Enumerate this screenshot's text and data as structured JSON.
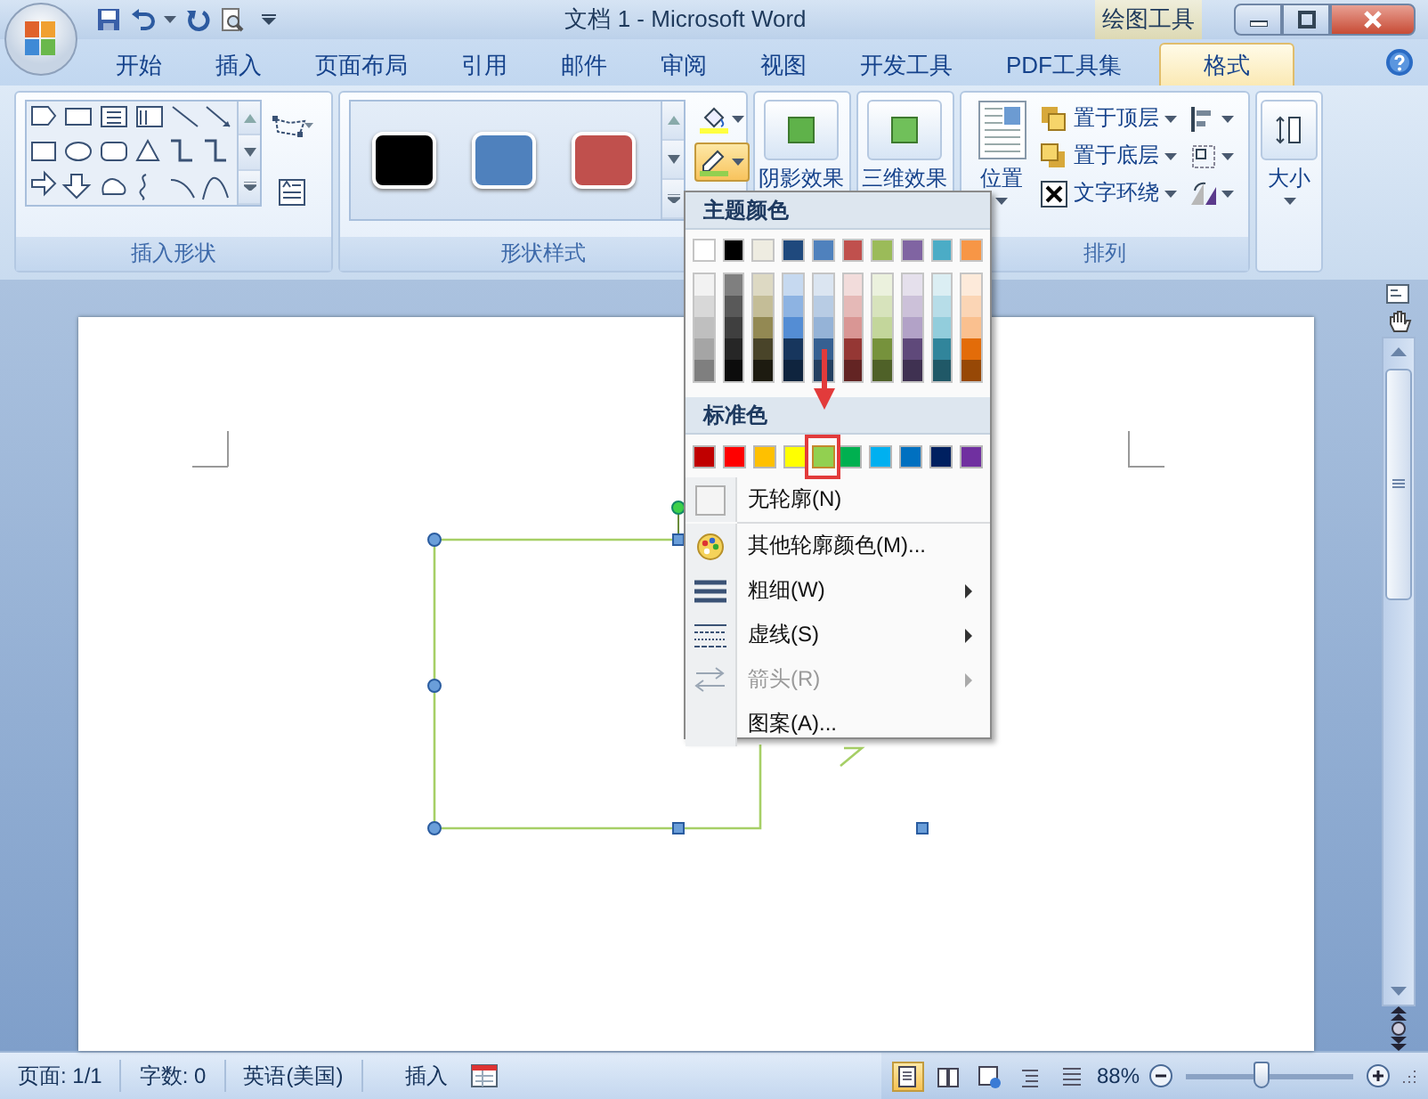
{
  "window": {
    "title": "文档 1 - Microsoft Word",
    "context_label": "绘图工具"
  },
  "tabs": [
    {
      "label": "开始",
      "selected": false
    },
    {
      "label": "插入",
      "selected": false
    },
    {
      "label": "页面布局",
      "selected": false
    },
    {
      "label": "引用",
      "selected": false
    },
    {
      "label": "邮件",
      "selected": false
    },
    {
      "label": "审阅",
      "selected": false
    },
    {
      "label": "视图",
      "selected": false
    },
    {
      "label": "开发工具",
      "selected": false
    },
    {
      "label": "PDF工具集",
      "selected": false
    },
    {
      "label": "格式",
      "selected": true
    }
  ],
  "ribbon": {
    "insert_shapes": {
      "label": "插入形状"
    },
    "shape_styles": {
      "label": "形状样式",
      "presets": [
        {
          "color": "#000000"
        },
        {
          "color": "#4f81bd"
        },
        {
          "color": "#c0504d"
        }
      ]
    },
    "shadow_effects": {
      "label": "阴影效果"
    },
    "effects_3d": {
      "label": "三维效果"
    },
    "arrange": {
      "label": "排列",
      "position": "位置",
      "buttons": [
        {
          "label": "置于顶层"
        },
        {
          "label": "置于底层"
        },
        {
          "label": "文字环绕"
        }
      ]
    },
    "size": {
      "label": "大小"
    }
  },
  "outline_menu": {
    "theme_heading": "主题颜色",
    "theme_colors": [
      {
        "color": "#ffffff",
        "shades": [
          {
            "color": "#f2f2f2"
          },
          {
            "color": "#d8d8d8"
          },
          {
            "color": "#bfbfbf"
          },
          {
            "color": "#a5a5a5"
          },
          {
            "color": "#7f7f7f"
          }
        ]
      },
      {
        "color": "#000000",
        "shades": [
          {
            "color": "#7f7f7f"
          },
          {
            "color": "#595959"
          },
          {
            "color": "#3f3f3f"
          },
          {
            "color": "#262626"
          },
          {
            "color": "#0c0c0c"
          }
        ]
      },
      {
        "color": "#eeece1",
        "shades": [
          {
            "color": "#ddd9c3"
          },
          {
            "color": "#c4bd97"
          },
          {
            "color": "#938953"
          },
          {
            "color": "#494429"
          },
          {
            "color": "#1d1b10"
          }
        ]
      },
      {
        "color": "#1f497d",
        "shades": [
          {
            "color": "#c6d9f0"
          },
          {
            "color": "#8db3e2"
          },
          {
            "color": "#548dd4"
          },
          {
            "color": "#17365d"
          },
          {
            "color": "#0f243e"
          }
        ]
      },
      {
        "color": "#4f81bd",
        "shades": [
          {
            "color": "#dbe5f1"
          },
          {
            "color": "#b8cce4"
          },
          {
            "color": "#95b3d7"
          },
          {
            "color": "#366092"
          },
          {
            "color": "#244061"
          }
        ]
      },
      {
        "color": "#c0504d",
        "shades": [
          {
            "color": "#f2dcdb"
          },
          {
            "color": "#e5b9b7"
          },
          {
            "color": "#d99694"
          },
          {
            "color": "#953734"
          },
          {
            "color": "#632423"
          }
        ]
      },
      {
        "color": "#9bbb59",
        "shades": [
          {
            "color": "#ebf1dd"
          },
          {
            "color": "#d7e3bc"
          },
          {
            "color": "#c3d69b"
          },
          {
            "color": "#76923c"
          },
          {
            "color": "#4f6128"
          }
        ]
      },
      {
        "color": "#8064a2",
        "shades": [
          {
            "color": "#e5e0ec"
          },
          {
            "color": "#ccc1d9"
          },
          {
            "color": "#b2a2c7"
          },
          {
            "color": "#5f497a"
          },
          {
            "color": "#3f3151"
          }
        ]
      },
      {
        "color": "#4bacc6",
        "shades": [
          {
            "color": "#dbeef3"
          },
          {
            "color": "#b7dde8"
          },
          {
            "color": "#92cddc"
          },
          {
            "color": "#31859b"
          },
          {
            "color": "#205867"
          }
        ]
      },
      {
        "color": "#f79646",
        "shades": [
          {
            "color": "#fdeada"
          },
          {
            "color": "#fbd5b5"
          },
          {
            "color": "#fac08f"
          },
          {
            "color": "#e36c09"
          },
          {
            "color": "#974806"
          }
        ]
      }
    ],
    "standard_heading": "标准色",
    "standard_colors": [
      {
        "color": "#c00000",
        "selected": false
      },
      {
        "color": "#ff0000",
        "selected": false
      },
      {
        "color": "#ffc000",
        "selected": false
      },
      {
        "color": "#ffff00",
        "selected": false
      },
      {
        "color": "#92d050",
        "selected": true
      },
      {
        "color": "#00b050",
        "selected": false
      },
      {
        "color": "#00b0f0",
        "selected": false
      },
      {
        "color": "#0070c0",
        "selected": false
      },
      {
        "color": "#002060",
        "selected": false
      },
      {
        "color": "#7030a0",
        "selected": false
      }
    ],
    "items": [
      {
        "kind": "no-outline",
        "label": "无轮廓(N)",
        "submenu": false,
        "disabled": false
      },
      {
        "kind": "more-colors",
        "label": "其他轮廓颜色(M)...",
        "submenu": false,
        "disabled": false
      },
      {
        "kind": "weight",
        "label": "粗细(W)",
        "submenu": true,
        "disabled": false
      },
      {
        "kind": "dash",
        "label": "虚线(S)",
        "submenu": true,
        "disabled": false
      },
      {
        "kind": "arrows",
        "label": "箭头(R)",
        "submenu": true,
        "disabled": true
      },
      {
        "kind": "pattern",
        "label": "图案(A)...",
        "submenu": false,
        "disabled": false
      }
    ]
  },
  "status_bar": {
    "page": "页面: 1/1",
    "words": "字数: 0",
    "language": "英语(美国)",
    "mode": "插入",
    "views": [
      {
        "selected": true
      },
      {
        "selected": false
      },
      {
        "selected": false
      },
      {
        "selected": false
      },
      {
        "selected": false
      }
    ],
    "zoom": "88%",
    "zoom_slider": {
      "level": 0.45
    }
  }
}
